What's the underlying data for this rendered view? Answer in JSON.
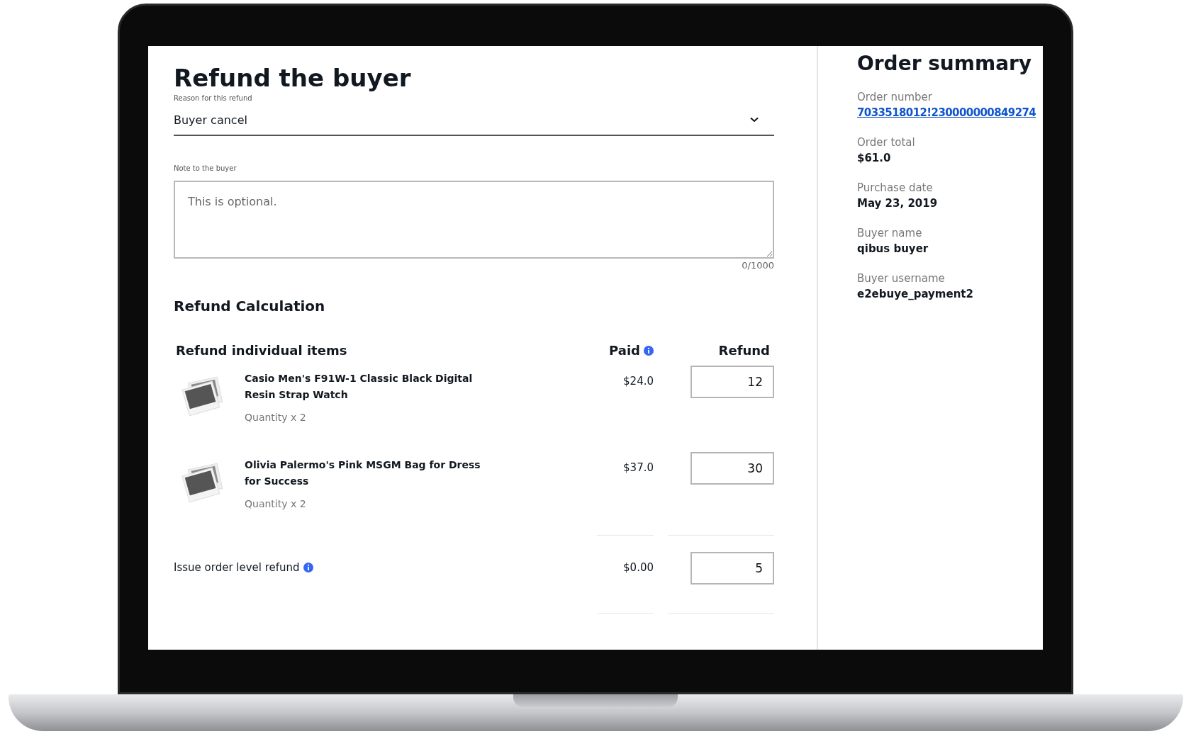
{
  "form": {
    "title": "Refund the buyer",
    "reason": {
      "label": "Reason for this refund",
      "value": "Buyer cancel"
    },
    "note": {
      "label": "Note to the buyer",
      "placeholder": "This is optional.",
      "counter": "0/1000"
    }
  },
  "calculation": {
    "title": "Refund Calculation",
    "columns": {
      "items": "Refund individual items",
      "paid": "Paid",
      "refund": "Refund"
    },
    "items": [
      {
        "name": "Casio Men's F91W-1 Classic Black Digital Resin Strap Watch",
        "quantity": "Quantity x 2",
        "paid": "$24.0",
        "refund": "12"
      },
      {
        "name": "Olivia Palermo's Pink MSGM Bag for Dress for Success",
        "quantity": "Quantity x 2",
        "paid": "$37.0",
        "refund": "30"
      }
    ],
    "order_level": {
      "label": "Issue order level refund",
      "paid": "$0.00",
      "refund": "5"
    }
  },
  "summary": {
    "title": "Order summary",
    "fields": [
      {
        "label": "Order number",
        "value": "7033518012!230000000849274",
        "kind": "link"
      },
      {
        "label": "Order total",
        "value": "$61.0",
        "kind": "text"
      },
      {
        "label": "Purchase date",
        "value": "May 23, 2019",
        "kind": "text"
      },
      {
        "label": "Buyer name",
        "value": "qibus buyer",
        "kind": "text"
      },
      {
        "label": "Buyer username",
        "value": "e2ebuye_payment2",
        "kind": "text"
      }
    ]
  }
}
